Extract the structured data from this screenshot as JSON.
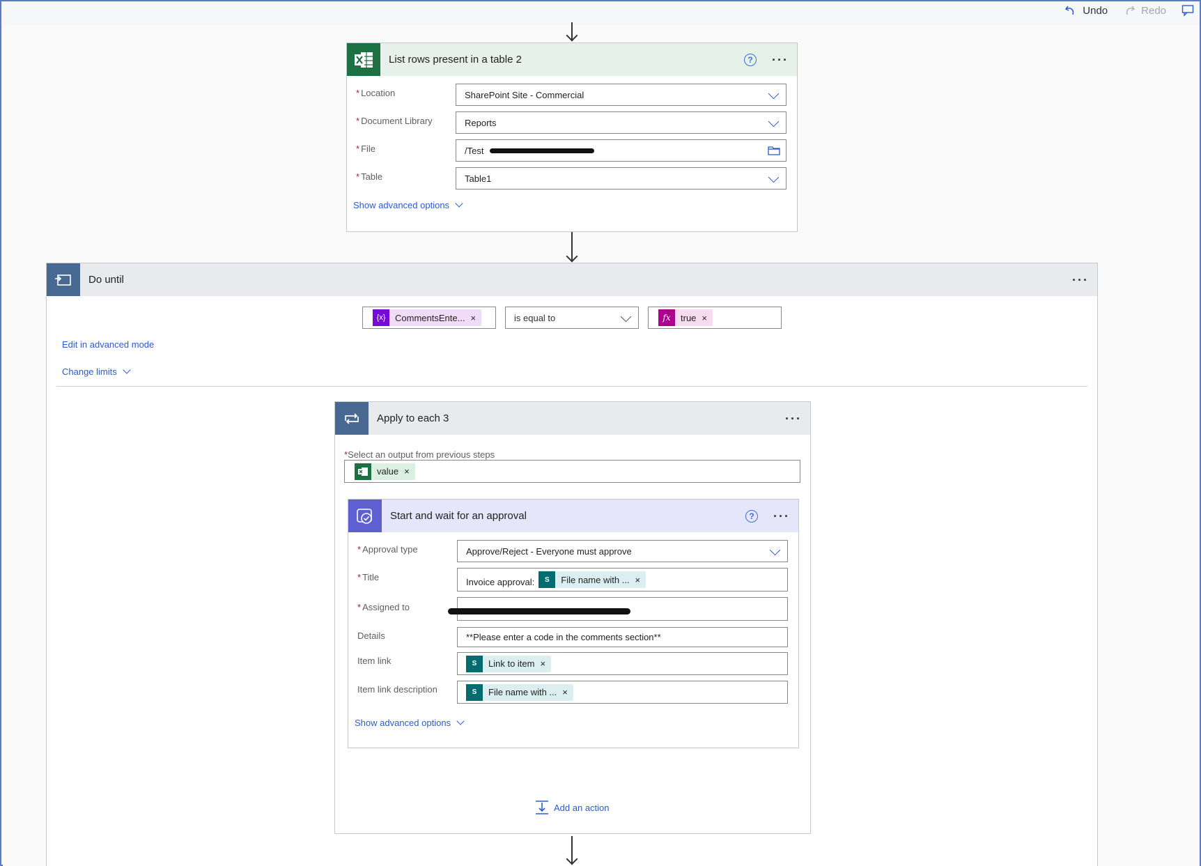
{
  "topbar": {
    "undo": "Undo",
    "redo": "Redo"
  },
  "colors": {
    "excel": "#1d7044",
    "loop": "#486991",
    "approval": "#5e5fd1",
    "sharepoint": "#036c70",
    "variable": "#770bd6",
    "expression": "#ad008c",
    "link": "#2a5bd1"
  },
  "list_rows": {
    "title": "List rows present in a table 2",
    "fields": [
      {
        "label": "Location",
        "required": true,
        "value": "SharePoint Site - Commercial",
        "control": "dropdown"
      },
      {
        "label": "Document Library",
        "required": true,
        "value": "Reports",
        "control": "dropdown"
      },
      {
        "label": "File",
        "required": true,
        "value": "/Test",
        "control": "file-picker"
      },
      {
        "label": "Table",
        "required": true,
        "value": "Table1",
        "control": "dropdown"
      }
    ],
    "advanced": "Show advanced options"
  },
  "do_until": {
    "title": "Do until",
    "condition": {
      "left": "CommentsEnte...",
      "operator": "is equal to",
      "right": "true"
    },
    "edit_advanced": "Edit in advanced mode",
    "change_limits": "Change limits"
  },
  "apply_each": {
    "title": "Apply to each 3",
    "select_label": "Select an output from previous steps",
    "select_token": "value"
  },
  "approval": {
    "title": "Start and wait for an approval",
    "approval_type_label": "Approval type",
    "approval_type_value": "Approve/Reject - Everyone must approve",
    "title_label": "Title",
    "title_prefix": "Invoice approval:",
    "title_token": "File name with ...",
    "assigned_label": "Assigned to",
    "details_label": "Details",
    "details_value": "**Please enter a code in the comments section**",
    "item_link_label": "Item link",
    "item_link_token": "Link to item",
    "item_link_desc_label": "Item link description",
    "item_link_desc_token": "File name with ...",
    "advanced": "Show advanced options"
  },
  "add_action": "Add an action"
}
